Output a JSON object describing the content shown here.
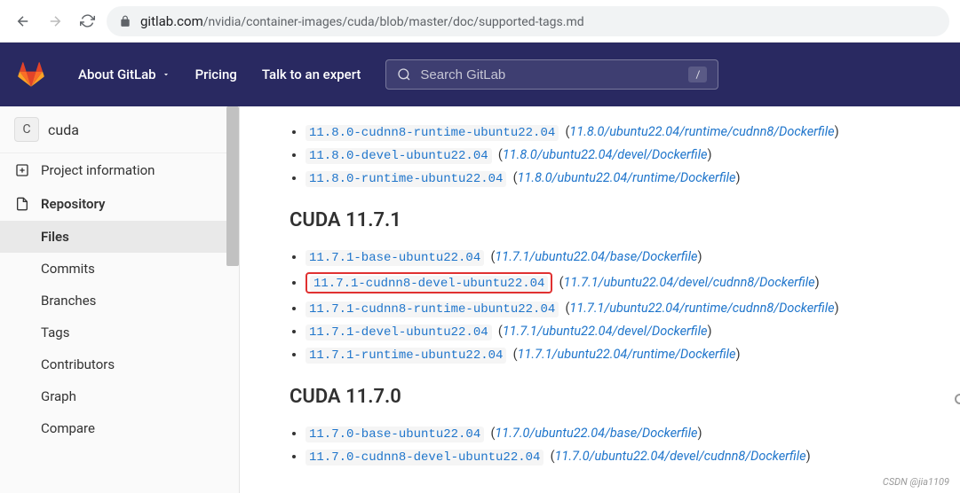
{
  "browser": {
    "url_host": "gitlab.com",
    "url_path": "/nvidia/container-images/cuda/blob/master/doc/supported-tags.md"
  },
  "header": {
    "nav": {
      "about": "About GitLab",
      "pricing": "Pricing",
      "expert": "Talk to an expert"
    },
    "search_placeholder": "Search GitLab",
    "shortcut": "/"
  },
  "sidebar": {
    "project_badge": "C",
    "project_name": "cuda",
    "items": {
      "project_info": "Project information",
      "repository": "Repository"
    },
    "sub_items": {
      "files": "Files",
      "commits": "Commits",
      "branches": "Branches",
      "tags": "Tags",
      "contributors": "Contributors",
      "graph": "Graph",
      "compare": "Compare"
    }
  },
  "content": {
    "sections": [
      {
        "heading": null,
        "items": [
          {
            "tag": "11.8.0-cudnn8-runtime-ubuntu22.04",
            "link": "11.8.0/ubuntu22.04/runtime/cudnn8/Dockerfile",
            "highlight": false
          },
          {
            "tag": "11.8.0-devel-ubuntu22.04",
            "link": "11.8.0/ubuntu22.04/devel/Dockerfile",
            "highlight": false
          },
          {
            "tag": "11.8.0-runtime-ubuntu22.04",
            "link": "11.8.0/ubuntu22.04/runtime/Dockerfile",
            "highlight": false
          }
        ]
      },
      {
        "heading": "CUDA 11.7.1",
        "items": [
          {
            "tag": "11.7.1-base-ubuntu22.04",
            "link": "11.7.1/ubuntu22.04/base/Dockerfile",
            "highlight": false
          },
          {
            "tag": "11.7.1-cudnn8-devel-ubuntu22.04",
            "link": "11.7.1/ubuntu22.04/devel/cudnn8/Dockerfile",
            "highlight": true
          },
          {
            "tag": "11.7.1-cudnn8-runtime-ubuntu22.04",
            "link": "11.7.1/ubuntu22.04/runtime/cudnn8/Dockerfile",
            "highlight": false
          },
          {
            "tag": "11.7.1-devel-ubuntu22.04",
            "link": "11.7.1/ubuntu22.04/devel/Dockerfile",
            "highlight": false
          },
          {
            "tag": "11.7.1-runtime-ubuntu22.04",
            "link": "11.7.1/ubuntu22.04/runtime/Dockerfile",
            "highlight": false
          }
        ]
      },
      {
        "heading": "CUDA 11.7.0",
        "items": [
          {
            "tag": "11.7.0-base-ubuntu22.04",
            "link": "11.7.0/ubuntu22.04/base/Dockerfile",
            "highlight": false
          },
          {
            "tag": "11.7.0-cudnn8-devel-ubuntu22.04",
            "link": "11.7.0/ubuntu22.04/devel/cudnn8/Dockerfile",
            "highlight": false
          }
        ]
      }
    ]
  },
  "watermark": "CSDN @jia1109"
}
